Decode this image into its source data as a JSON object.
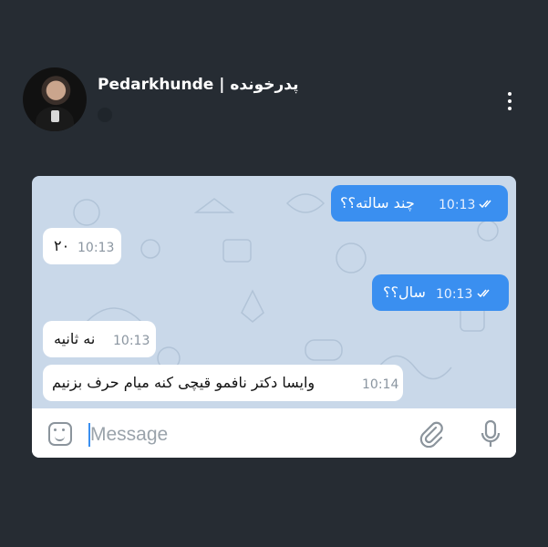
{
  "chat": {
    "title": "Pedarkhunde | پدرخونده",
    "messages": [
      {
        "direction": "outgoing",
        "text": "چند سالته؟؟",
        "time": "10:13",
        "read": true
      },
      {
        "direction": "incoming",
        "text": "۲۰",
        "time": "10:13"
      },
      {
        "direction": "outgoing",
        "text": "سال؟؟",
        "time": "10:13",
        "read": true
      },
      {
        "direction": "incoming",
        "text": "نه ثانیه",
        "time": "10:13"
      },
      {
        "direction": "incoming",
        "text": "وایسا دکتر نافمو قیچی کنه میام حرف بزنیم",
        "time": "10:14"
      }
    ]
  },
  "input": {
    "placeholder": "Message",
    "value": ""
  },
  "icons": {
    "menu": "kebab-menu-icon",
    "sticker": "sticker-icon",
    "attach": "paperclip-icon",
    "mic": "microphone-icon",
    "read_receipt": "double-check-icon"
  },
  "colors": {
    "background": "#262c33",
    "outgoing_bubble": "#3a8ff0",
    "incoming_bubble": "#ffffff",
    "chat_background": "#c9d8e9"
  }
}
